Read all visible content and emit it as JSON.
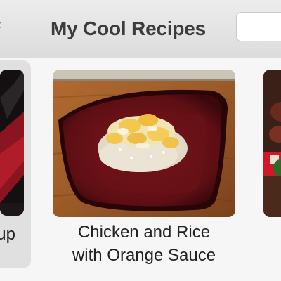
{
  "window": {
    "title": "My Cool Recipes",
    "back_glyph": "‹"
  },
  "search": {
    "placeholder": ""
  },
  "recipes": [
    {
      "caption_line1": "up",
      "caption_line2": "",
      "photo_icon": "recipe-photo-red-dish",
      "selected": true
    },
    {
      "caption_line1": "Chicken and Rice",
      "caption_line2": "with Orange Sauce",
      "photo_icon": "recipe-photo-chicken-rice",
      "selected": false
    },
    {
      "caption_line1": "",
      "caption_line2": "",
      "photo_icon": "recipe-photo-dark-dish",
      "selected": false
    }
  ],
  "colors": {
    "titlebar": "#e2e2e2",
    "background": "#f6f6f6",
    "selection": "#e0e0e0",
    "plate": "#6e1418",
    "table": "#9a5a2a"
  }
}
